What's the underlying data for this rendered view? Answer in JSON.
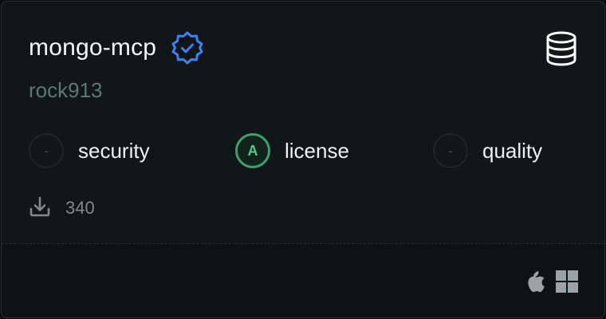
{
  "server": {
    "name": "mongo-mcp",
    "author": "rock913",
    "verified_icon": "verified-badge-icon",
    "type_icon": "database-icon"
  },
  "scores": [
    {
      "grade": "-",
      "label": "security"
    },
    {
      "grade": "A",
      "label": "license"
    },
    {
      "grade": "-",
      "label": "quality"
    }
  ],
  "downloads": {
    "icon": "download-icon",
    "count": "340"
  },
  "platforms": [
    "apple-icon",
    "windows-icon"
  ],
  "colors": {
    "verified": "#3b82f6",
    "grade_a": "#3aa36c",
    "author": "#5f7676"
  }
}
